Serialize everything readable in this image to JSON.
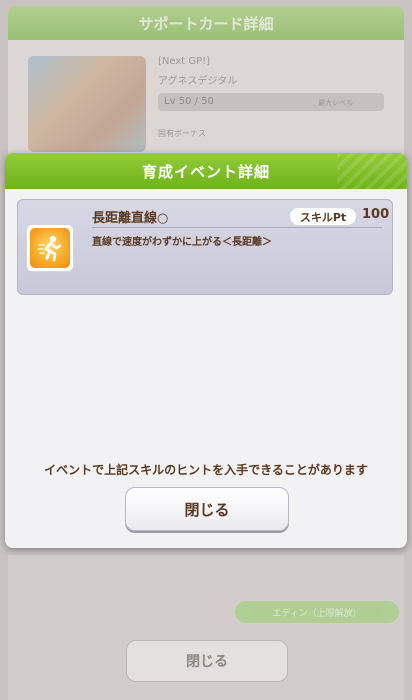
{
  "background": {
    "header_title": "サポートカード詳細",
    "card_epithet": "[Next GP!]",
    "card_character": "アグネスデジタル",
    "level_text": "Lv 50 / 50",
    "level_status": "最大レベル",
    "item_label": "固有ボーナス",
    "green_button_label": "エディン（上限解放）",
    "close_label": "閉じる"
  },
  "dialog": {
    "title": "育成イベント詳細",
    "event": {
      "skill_name": "長距離直線○",
      "skill_pt_label": "スキルPt",
      "skill_pt_value": "100",
      "description": "直線で速度がわずかに上がる＜長距離＞",
      "icon": "speed-up-skill-icon"
    },
    "message": "イベントで上記スキルのヒントを入手できることがあります",
    "close_label": "閉じる"
  },
  "colors": {
    "header_green": "#7dbf2a",
    "text_brown": "#5a3a22",
    "card_lavender": "#d0cfde",
    "skill_icon_orange": "#f7a828"
  }
}
